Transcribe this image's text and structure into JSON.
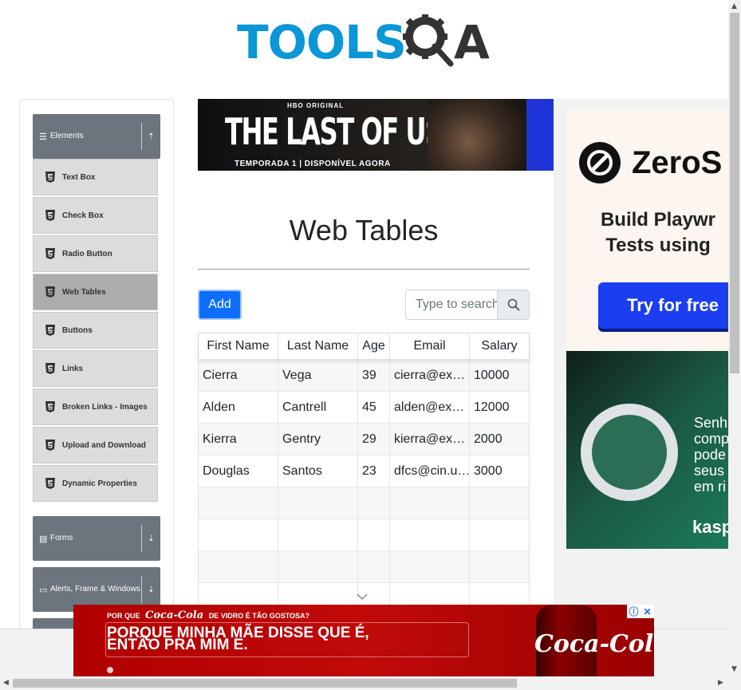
{
  "logo": {
    "text": "TOOLS",
    "suffix": "A"
  },
  "sidebar": {
    "groups": [
      {
        "label": "Elements",
        "icon": "hamburger-icon",
        "expanded": true
      },
      {
        "label": "Forms",
        "icon": "form-icon",
        "expanded": false
      },
      {
        "label": "Alerts, Frame & Windows",
        "icon": "window-icon",
        "expanded": false
      }
    ],
    "items": [
      {
        "label": "Text Box"
      },
      {
        "label": "Check Box"
      },
      {
        "label": "Radio Button"
      },
      {
        "label": "Web Tables",
        "active": true
      },
      {
        "label": "Buttons"
      },
      {
        "label": "Links"
      },
      {
        "label": "Broken Links - Images"
      },
      {
        "label": "Upload and Download"
      },
      {
        "label": "Dynamic Properties"
      }
    ]
  },
  "banner_ad": {
    "brand": "HBO ORIGINAL",
    "title": "THE LAST OF US",
    "subtitle": "TEMPORADA 1 | DISPONÍVEL AGORA"
  },
  "main": {
    "title": "Web Tables",
    "add_label": "Add",
    "search_placeholder": "Type to search"
  },
  "table": {
    "columns": [
      "First Name",
      "Last Name",
      "Age",
      "Email",
      "Salary"
    ],
    "rows": [
      [
        "Cierra",
        "Vega",
        "39",
        "cierra@ex…",
        "10000"
      ],
      [
        "Alden",
        "Cantrell",
        "45",
        "alden@ex…",
        "12000"
      ],
      [
        "Kierra",
        "Gentry",
        "29",
        "kierra@ex…",
        "2000"
      ],
      [
        "Douglas",
        "Santos",
        "23",
        "dfcs@cin.u…",
        "3000"
      ],
      [
        "",
        "",
        "",
        "",
        ""
      ],
      [
        "",
        "",
        "",
        "",
        ""
      ],
      [
        "",
        "",
        "",
        "",
        ""
      ]
    ]
  },
  "right_ad": {
    "brand": "ZeroS",
    "line1": "Build Playwr",
    "line2": "Tests using",
    "cta": "Try for free",
    "green_lines": [
      "Senh",
      "comp",
      "pode",
      "seus",
      "em ri"
    ],
    "green_brand": "kasp"
  },
  "bottom_ad": {
    "top_left": "POR QUE",
    "brand": "Coca-Cola",
    "top_right": "DE VIDRO É TÃO GOSTOSA?",
    "main_line1": "PORQUE MINHA MÃE DISSE QUE É,",
    "main_line2": "ENTÃO PRA MIM E.",
    "logo": "Coca-Cola",
    "info_icon": "ⓘ",
    "close_icon": "✕"
  },
  "colors": {
    "primary": "#0d6efd",
    "sidebar_header": "#6c757d",
    "logo_blue": "#0b96d6"
  }
}
